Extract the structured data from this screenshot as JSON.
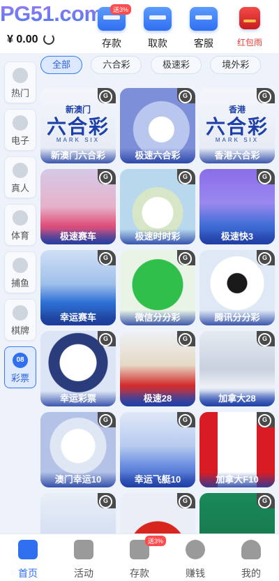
{
  "header": {
    "logo": "PG51.com",
    "balance": "¥ 0.00",
    "actions": [
      {
        "label": "存款",
        "badge": "送3%"
      },
      {
        "label": "取款"
      },
      {
        "label": "客服"
      },
      {
        "label": "红包雨"
      }
    ]
  },
  "filters": [
    "全部",
    "六合彩",
    "极速彩",
    "境外彩"
  ],
  "sidebar": [
    {
      "label": "热门"
    },
    {
      "label": "电子"
    },
    {
      "label": "真人"
    },
    {
      "label": "体育"
    },
    {
      "label": "捕鱼"
    },
    {
      "label": "棋牌"
    },
    {
      "label": "彩票",
      "icon_text": "08"
    }
  ],
  "games": [
    {
      "name": "新澳门六合彩",
      "art_top": "新澳门",
      "art_big": "六合彩",
      "art_sub": "MARK SIX"
    },
    {
      "name": "极速六合彩"
    },
    {
      "name": "香港六合彩",
      "art_top": "香港",
      "art_big": "六合彩",
      "art_sub": "MARK SIX"
    },
    {
      "name": "极速赛车"
    },
    {
      "name": "极速时时彩"
    },
    {
      "name": "极速快3"
    },
    {
      "name": "幸运赛车"
    },
    {
      "name": "微信分分彩"
    },
    {
      "name": "腾讯分分彩"
    },
    {
      "name": "幸运彩票"
    },
    {
      "name": "极速28"
    },
    {
      "name": "加拿大28"
    },
    {
      "name": "澳门幸运10"
    },
    {
      "name": "幸运飞艇10"
    },
    {
      "name": "加拿大F10"
    },
    {
      "name": ""
    },
    {
      "name": ""
    },
    {
      "name": ""
    }
  ],
  "nav": [
    {
      "label": "首页"
    },
    {
      "label": "活动"
    },
    {
      "label": "存款",
      "badge": "送3%"
    },
    {
      "label": "赚钱"
    },
    {
      "label": "我的"
    }
  ],
  "colors": {
    "accent": "#2f6ff0",
    "danger": "#e53935",
    "background": "#eef3fb"
  }
}
